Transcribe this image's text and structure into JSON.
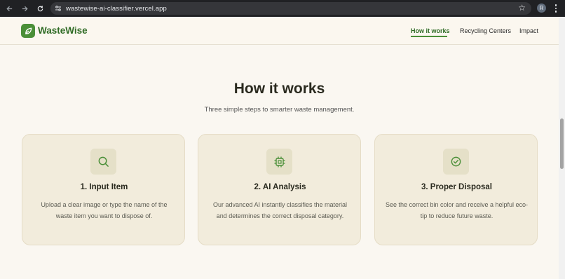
{
  "browser": {
    "url": "wastewise-ai-classifier.vercel.app",
    "profile_initial": "R"
  },
  "header": {
    "brand": "WasteWise",
    "nav": [
      {
        "label": "How it works",
        "active": true
      },
      {
        "label": "Recycling Centers",
        "active": false
      },
      {
        "label": "Impact",
        "active": false
      }
    ]
  },
  "section": {
    "title": "How it works",
    "subtitle": "Three simple steps to smarter waste management.",
    "steps": [
      {
        "icon": "search-icon",
        "title": "1. Input Item",
        "description": "Upload a clear image or type the name of the waste item you want to dispose of."
      },
      {
        "icon": "chip-icon",
        "title": "2. AI Analysis",
        "description": "Our advanced AI instantly classifies the material and determines the correct disposal category."
      },
      {
        "icon": "check-circle-icon",
        "title": "3. Proper Disposal",
        "description": "See the correct bin color and receive a helpful eco-tip to reduce future waste."
      }
    ]
  },
  "colors": {
    "brand_green": "#4a8f38",
    "background": "#faf7f1",
    "card": "#f2ecdc"
  }
}
